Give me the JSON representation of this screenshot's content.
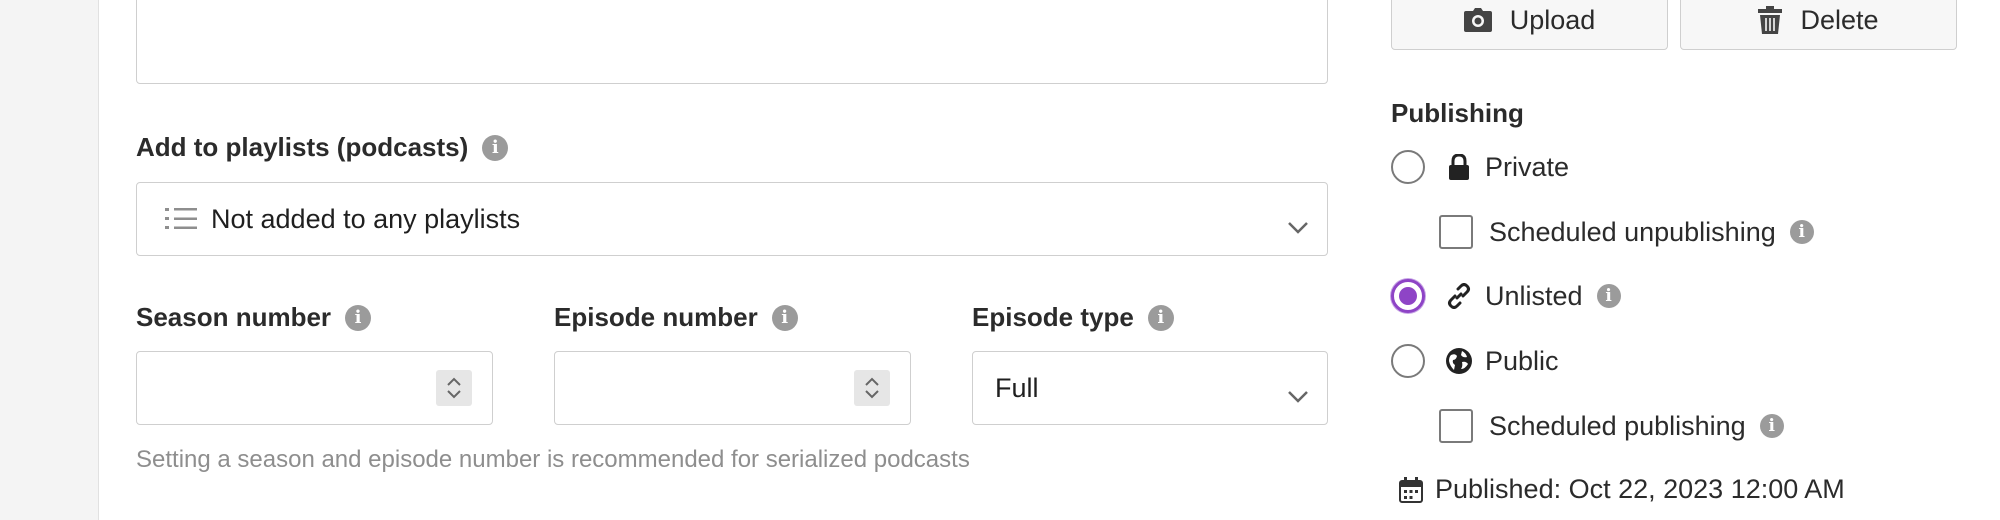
{
  "form": {
    "playlists": {
      "label": "Add to playlists (podcasts)",
      "selected": "Not added to any playlists"
    },
    "season": {
      "label": "Season number",
      "value": ""
    },
    "episode": {
      "label": "Episode number",
      "value": ""
    },
    "episode_type": {
      "label": "Episode type",
      "selected": "Full"
    },
    "hint": "Setting a season and episode number is recommended for serialized podcasts"
  },
  "sidebar": {
    "upload_label": "Upload",
    "delete_label": "Delete",
    "publishing": {
      "title": "Publishing",
      "private_label": "Private",
      "scheduled_unpublishing_label": "Scheduled unpublishing",
      "unlisted_label": "Unlisted",
      "public_label": "Public",
      "scheduled_publishing_label": "Scheduled publishing",
      "selected": "Unlisted",
      "published_text": "Published: Oct 22, 2023 12:00 AM"
    }
  },
  "colors": {
    "accent": "#8e44c6",
    "border": "#cfcfcf",
    "muted": "#8e8e8e"
  }
}
